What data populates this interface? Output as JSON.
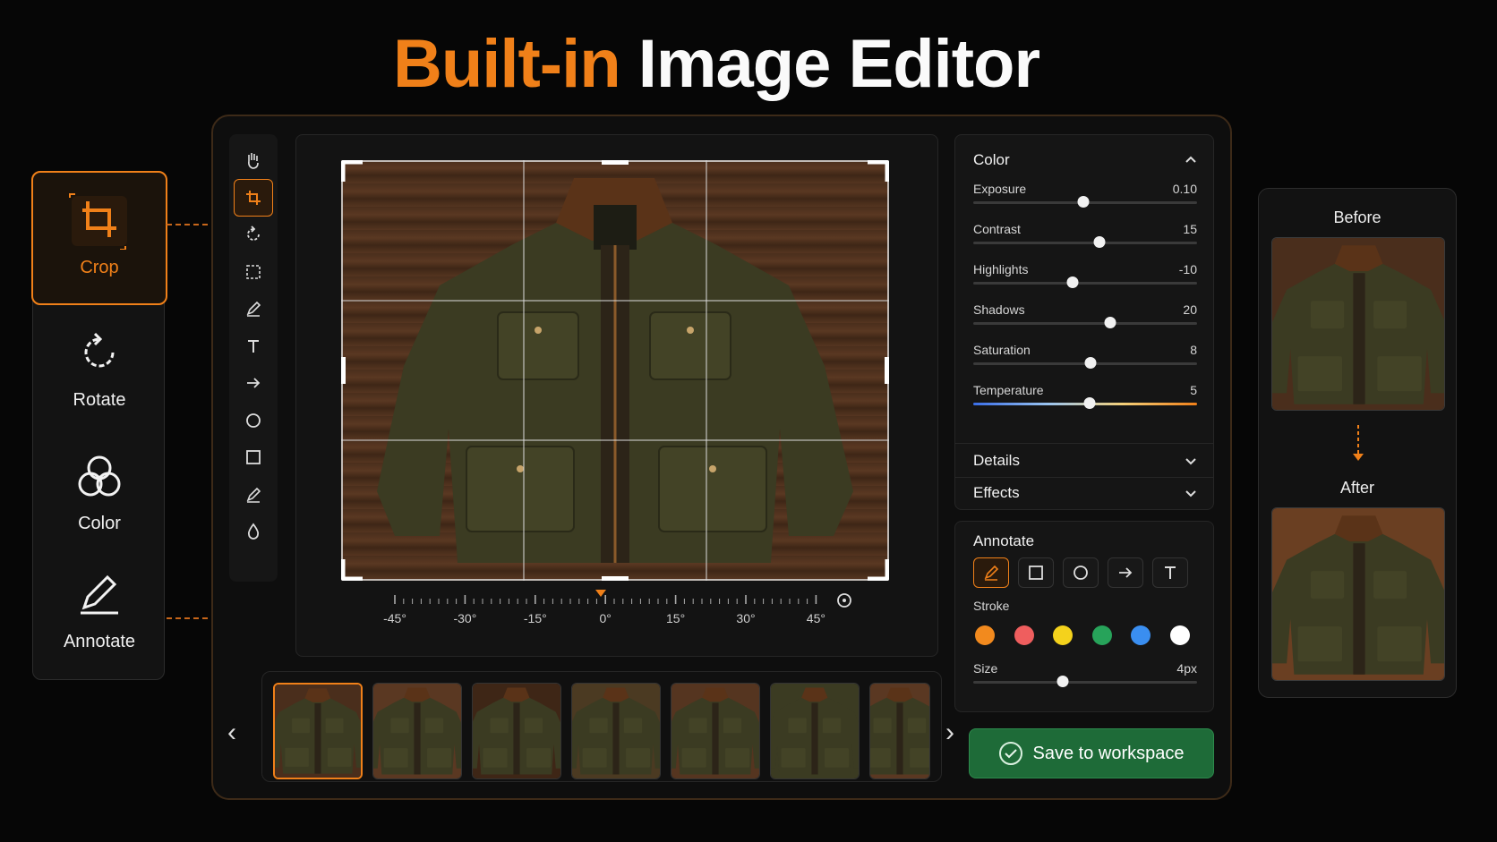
{
  "hero": {
    "accent": "Built-in",
    "rest": " Image Editor"
  },
  "features": [
    {
      "label": "Crop",
      "icon": "crop-icon",
      "active": true
    },
    {
      "label": "Rotate",
      "icon": "rotate-icon"
    },
    {
      "label": "Color",
      "icon": "color-icon"
    },
    {
      "label": "Annotate",
      "icon": "pencil-icon"
    }
  ],
  "toolbar": [
    "hand-icon",
    "crop-icon",
    "rotate-icon",
    "selection-icon",
    "pen-icon",
    "text-icon",
    "arrow-icon",
    "circle-icon",
    "square-icon",
    "brush-icon",
    "drop-icon"
  ],
  "rotation": {
    "ticks": [
      "-45°",
      "-30°",
      "-15°",
      "0°",
      "15°",
      "30°",
      "45°"
    ],
    "value": "0°"
  },
  "color_panel": {
    "title": "Color",
    "sliders": [
      {
        "name": "Exposure",
        "value": "0.10",
        "fraction": 0.49
      },
      {
        "name": "Contrast",
        "value": "15",
        "fraction": 0.565
      },
      {
        "name": "Highlights",
        "value": "-10",
        "fraction": 0.445
      },
      {
        "name": "Shadows",
        "value": "20",
        "fraction": 0.61
      },
      {
        "name": "Saturation",
        "value": "8",
        "fraction": 0.525
      },
      {
        "name": "Temperature",
        "value": "5",
        "fraction": 0.52
      }
    ]
  },
  "details": {
    "title": "Details"
  },
  "effects": {
    "title": "Effects"
  },
  "annotate": {
    "title": "Annotate",
    "tools": [
      "pencil-icon",
      "rectangle-icon",
      "circle-icon",
      "arrow-icon",
      "text-icon"
    ],
    "stroke_label": "Stroke",
    "stroke_colors": [
      "#f28a1e",
      "#ef5e5e",
      "#f4d21c",
      "#27a35a",
      "#3a8ef0",
      "#ffffff"
    ],
    "size_label": "Size",
    "size_value": "4px",
    "size_fraction": 0.4
  },
  "save_label": "Save to workspace",
  "before_after": {
    "before": "Before",
    "after": "After"
  },
  "thumbnails": 7
}
